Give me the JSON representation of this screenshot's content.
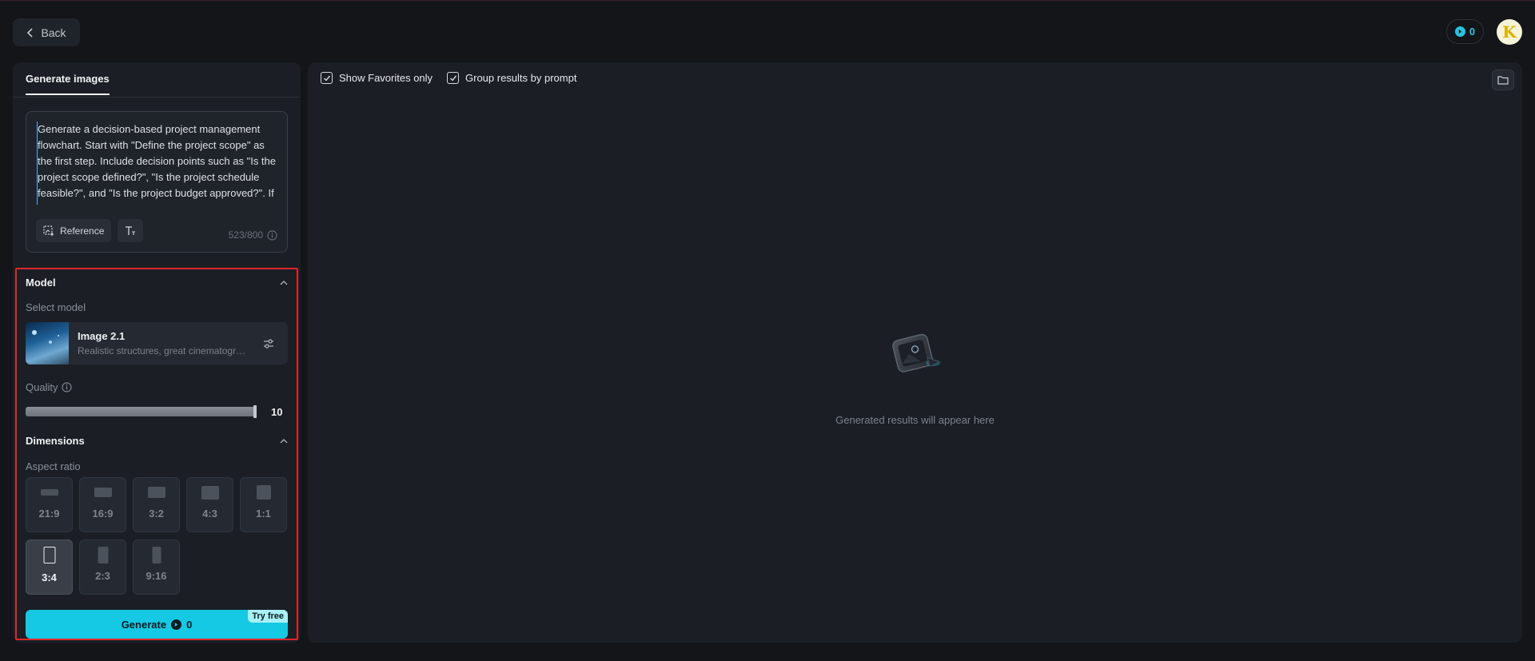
{
  "header": {
    "back_label": "Back",
    "credits": "0",
    "avatar_letter": "K"
  },
  "left": {
    "tab_label": "Generate images",
    "prompt_text": "Generate a decision-based project management flowchart. Start with \"Define the project scope\" as the first step. Include decision points such as \"Is the project scope defined?\", \"Is the project schedule feasible?\", and \"Is the project budget approved?\". If \"No\", loop back to reflect the scope,",
    "reference_label": "Reference",
    "char_count": "523/800"
  },
  "model_section": {
    "title": "Model",
    "select_label": "Select model",
    "model_name": "Image 2.1",
    "model_desc": "Realistic structures, great cinematography",
    "quality_label": "Quality",
    "quality_value": "10",
    "quality_fraction": 1.0
  },
  "dimensions_section": {
    "title": "Dimensions",
    "aspect_label": "Aspect ratio",
    "ratios": [
      {
        "label": "21:9",
        "active": false
      },
      {
        "label": "16:9",
        "active": false
      },
      {
        "label": "3:2",
        "active": false
      },
      {
        "label": "4:3",
        "active": false
      },
      {
        "label": "1:1",
        "active": false
      },
      {
        "label": "3:4",
        "active": true
      },
      {
        "label": "2:3",
        "active": false
      },
      {
        "label": "9:16",
        "active": false
      }
    ]
  },
  "generate": {
    "label": "Generate",
    "cost": "0",
    "badge": "Try free"
  },
  "results": {
    "show_favorites_label": "Show Favorites only",
    "group_label": "Group results by prompt",
    "empty_text": "Generated results will appear here"
  },
  "colors": {
    "accent": "#15c8e3",
    "highlight_border": "#e0262a"
  }
}
